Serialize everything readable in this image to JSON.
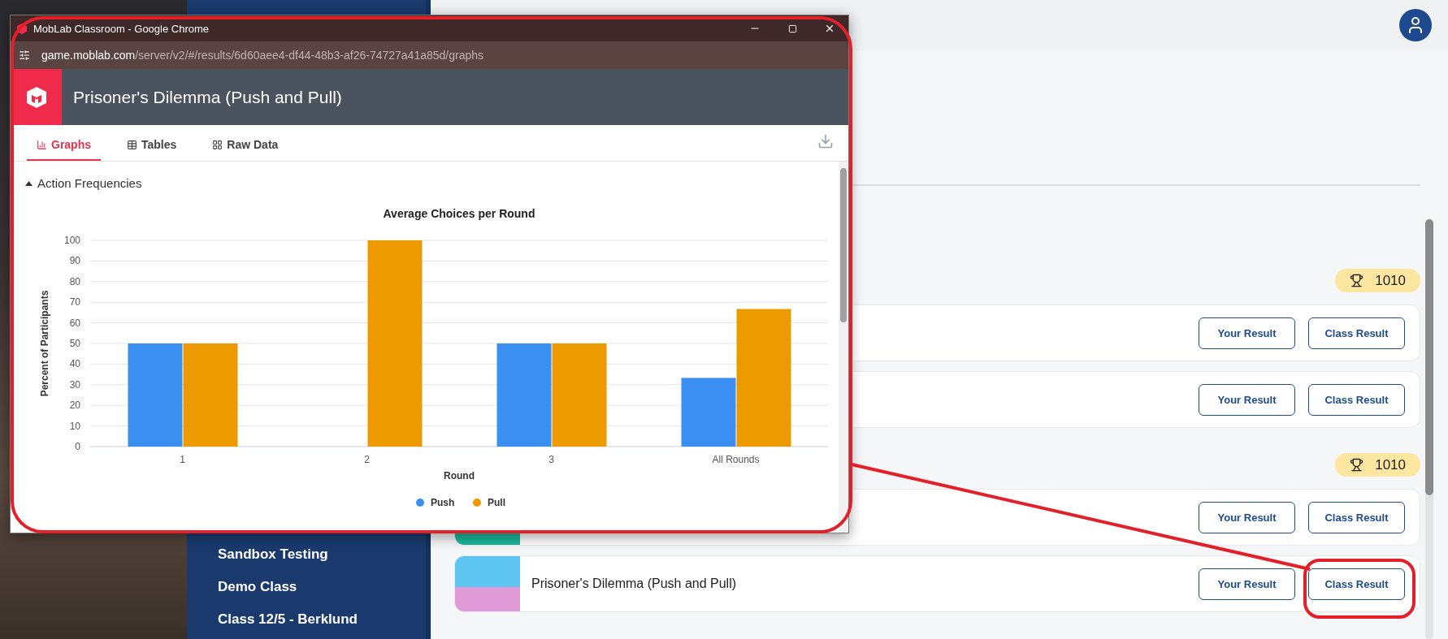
{
  "sidebar": {
    "items": [
      {
        "label": "Sandbox Testing"
      },
      {
        "label": "Demo Class"
      },
      {
        "label": "Class 12/5 - Berklund"
      }
    ]
  },
  "groups": [
    {
      "badge": "1010",
      "rows": [
        {
          "buttons": [
            "Your Result",
            "Class Result"
          ]
        },
        {
          "buttons": [
            "Your Result",
            "Class Result"
          ]
        }
      ]
    },
    {
      "badge": "1010",
      "rows": [
        {
          "buttons": [
            "Your Result",
            "Class Result"
          ]
        },
        {
          "title": "Prisoner's Dilemma (Push and Pull)",
          "buttons": [
            "Your Result",
            "Class Result"
          ]
        }
      ]
    }
  ],
  "popup": {
    "window_title": "MobLab Classroom - Google Chrome",
    "url_host": "game.moblab.com",
    "url_path": "/server/v2/#/results/6d60aee4-df44-48b3-af26-74727a41a85d/graphs",
    "app_title": "Prisoner's Dilemma (Push and Pull)",
    "tabs": [
      {
        "label": "Graphs",
        "kind": "graphs",
        "selected": true
      },
      {
        "label": "Tables",
        "kind": "tables",
        "selected": false
      },
      {
        "label": "Raw Data",
        "kind": "raw",
        "selected": false
      }
    ],
    "section": {
      "title": "Action Frequencies",
      "expanded": true
    },
    "chart_data": {
      "type": "bar",
      "title": "Average Choices per Round",
      "xlabel": "Round",
      "ylabel": "Percent of Participants",
      "categories": [
        "1",
        "2",
        "3",
        "All Rounds"
      ],
      "ylim": [
        0,
        100
      ],
      "grid": true,
      "legend": true,
      "yticks": [
        0,
        10,
        20,
        30,
        40,
        50,
        60,
        70,
        80,
        90,
        100
      ],
      "series": [
        {
          "name": "Push",
          "color": "#3a8ff0",
          "values": [
            50,
            0,
            50,
            33.3
          ]
        },
        {
          "name": "Pull",
          "color": "#ec9a00",
          "values": [
            50,
            100,
            50,
            66.7
          ]
        }
      ]
    }
  }
}
